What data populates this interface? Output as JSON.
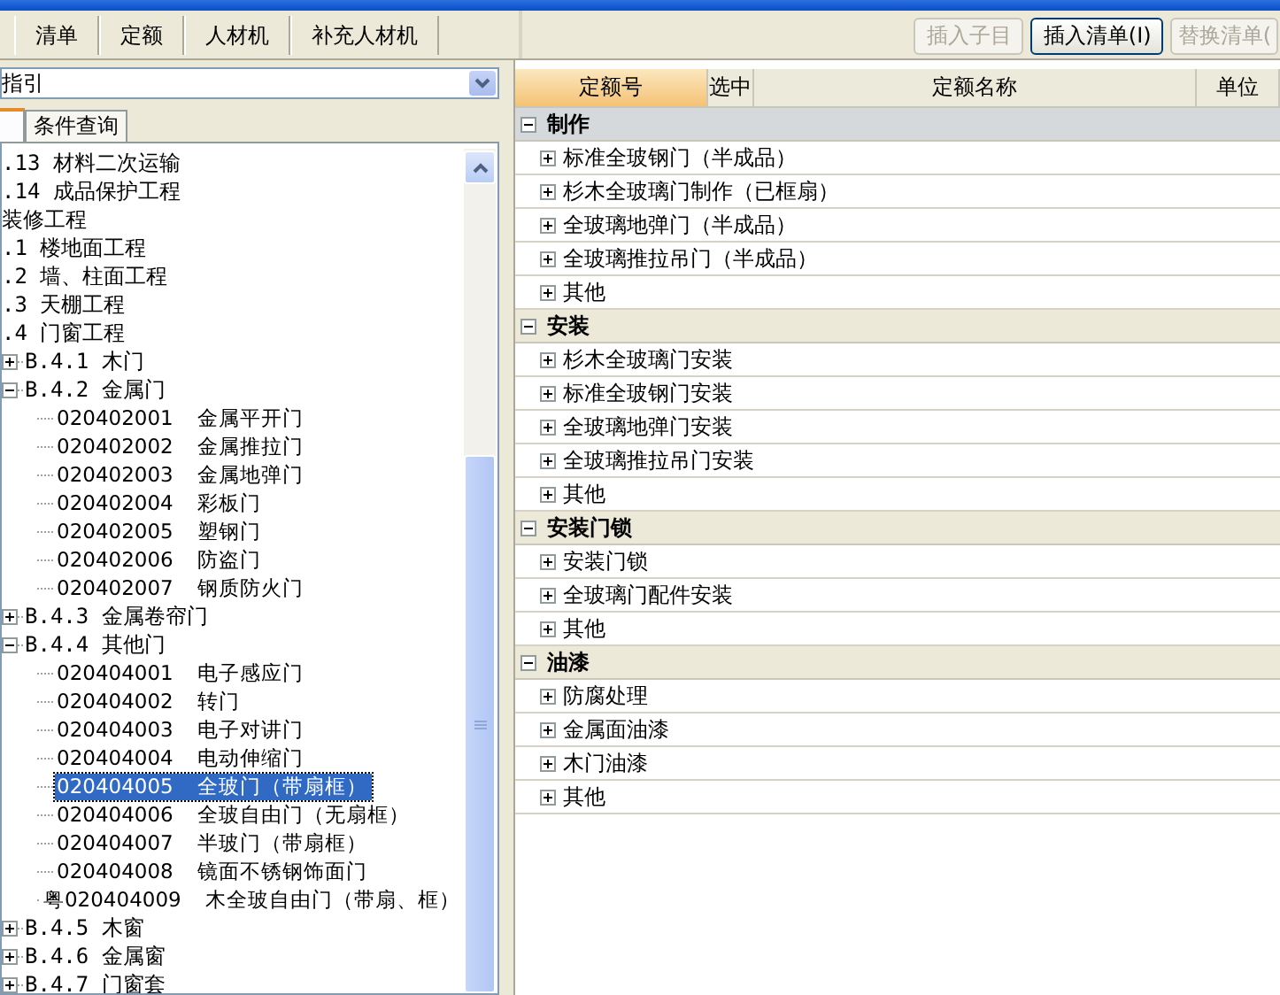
{
  "toolbar_tabs": [
    {
      "label": "清单"
    },
    {
      "label": "定额"
    },
    {
      "label": "人材机"
    },
    {
      "label": "补充人材机"
    }
  ],
  "toolbar_buttons": [
    {
      "label": "插入子目",
      "disabled": true
    },
    {
      "label": "插入清单(I)",
      "disabled": false
    },
    {
      "label": "替换清单(",
      "disabled": true
    }
  ],
  "guide": {
    "dropdown": {
      "value": "指引"
    },
    "tabs": [
      {
        "selected": true
      },
      {
        "label": "条件查询",
        "selected": false
      }
    ],
    "tree": [
      {
        "label": ".13 材料二次运输"
      },
      {
        "label": ".14 成品保护工程"
      },
      {
        "label": "装修工程"
      },
      {
        "label": ".1 楼地面工程"
      },
      {
        "label": ".2 墙、柱面工程"
      },
      {
        "label": ".3 天棚工程"
      },
      {
        "label": ".4 门窗工程",
        "children": [
          {
            "label": "B.4.1 木门",
            "expanded": false
          },
          {
            "label": "B.4.2 金属门",
            "expanded": true,
            "children": [
              {
                "code": "020402001",
                "name": "金属平开门",
                "selected": false
              },
              {
                "code": "020402002",
                "name": "金属推拉门",
                "selected": false
              },
              {
                "code": "020402003",
                "name": "金属地弹门",
                "selected": false
              },
              {
                "code": "020402004",
                "name": "彩板门",
                "selected": false
              },
              {
                "code": "020402005",
                "name": "塑钢门",
                "selected": false
              },
              {
                "code": "020402006",
                "name": "防盗门",
                "selected": false
              },
              {
                "code": "020402007",
                "name": "钢质防火门",
                "selected": false
              }
            ]
          },
          {
            "label": "B.4.3 金属卷帘门",
            "expanded": false
          },
          {
            "label": "B.4.4 其他门",
            "expanded": true,
            "children": [
              {
                "code": "020404001",
                "name": "电子感应门",
                "selected": false
              },
              {
                "code": "020404002",
                "name": "转门",
                "selected": false
              },
              {
                "code": "020404003",
                "name": "电子对讲门",
                "selected": false
              },
              {
                "code": "020404004",
                "name": "电动伸缩门",
                "selected": false
              },
              {
                "code": "020404005",
                "name": "全玻门（带扇框）",
                "selected": true
              },
              {
                "code": "020404006",
                "name": "全玻自由门（无扇框）",
                "selected": false
              },
              {
                "code": "020404007",
                "name": "半玻门（带扇框）",
                "selected": false
              },
              {
                "code": "020404008",
                "name": "镜面不锈钢饰面门",
                "selected": false
              },
              {
                "code": "粤020404009",
                "name": "木全玻自由门（带扇、框）",
                "selected": false
              }
            ]
          },
          {
            "label": "B.4.5 木窗",
            "expanded": false
          },
          {
            "label": "B.4.6 金属窗",
            "expanded": false
          },
          {
            "label": "B.4.7 门窗套",
            "expanded": false
          }
        ]
      }
    ]
  },
  "grid": {
    "columns": [
      {
        "label": "定额号",
        "selected": true
      },
      {
        "label": "选中",
        "selected": false
      },
      {
        "label": "定额名称",
        "selected": false
      },
      {
        "label": "单位",
        "selected": false
      }
    ],
    "groups": [
      {
        "name": "制作",
        "expanded": true,
        "selected": true,
        "items": [
          {
            "label": "标准全玻钢门（半成品）",
            "expanded": false
          },
          {
            "label": "杉木全玻璃门制作（已框扇）",
            "expanded": false
          },
          {
            "label": "全玻璃地弹门（半成品）",
            "expanded": false
          },
          {
            "label": "全玻璃推拉吊门（半成品）",
            "expanded": false
          },
          {
            "label": "其他",
            "expanded": false
          }
        ]
      },
      {
        "name": "安装",
        "expanded": true,
        "selected": false,
        "items": [
          {
            "label": "杉木全玻璃门安装",
            "expanded": false
          },
          {
            "label": "标准全玻钢门安装",
            "expanded": false
          },
          {
            "label": "全玻璃地弹门安装",
            "expanded": false
          },
          {
            "label": "全玻璃推拉吊门安装",
            "expanded": false
          },
          {
            "label": "其他",
            "expanded": false
          }
        ]
      },
      {
        "name": "安装门锁",
        "expanded": true,
        "selected": false,
        "items": [
          {
            "label": "安装门锁",
            "expanded": false
          },
          {
            "label": "全玻璃门配件安装",
            "expanded": false
          },
          {
            "label": "其他",
            "expanded": false
          }
        ]
      },
      {
        "name": "油漆",
        "expanded": true,
        "selected": false,
        "items": [
          {
            "label": "防腐处理",
            "expanded": false
          },
          {
            "label": "金属面油漆",
            "expanded": false
          },
          {
            "label": "木门油漆",
            "expanded": false
          },
          {
            "label": "其他",
            "expanded": false
          }
        ]
      }
    ]
  }
}
